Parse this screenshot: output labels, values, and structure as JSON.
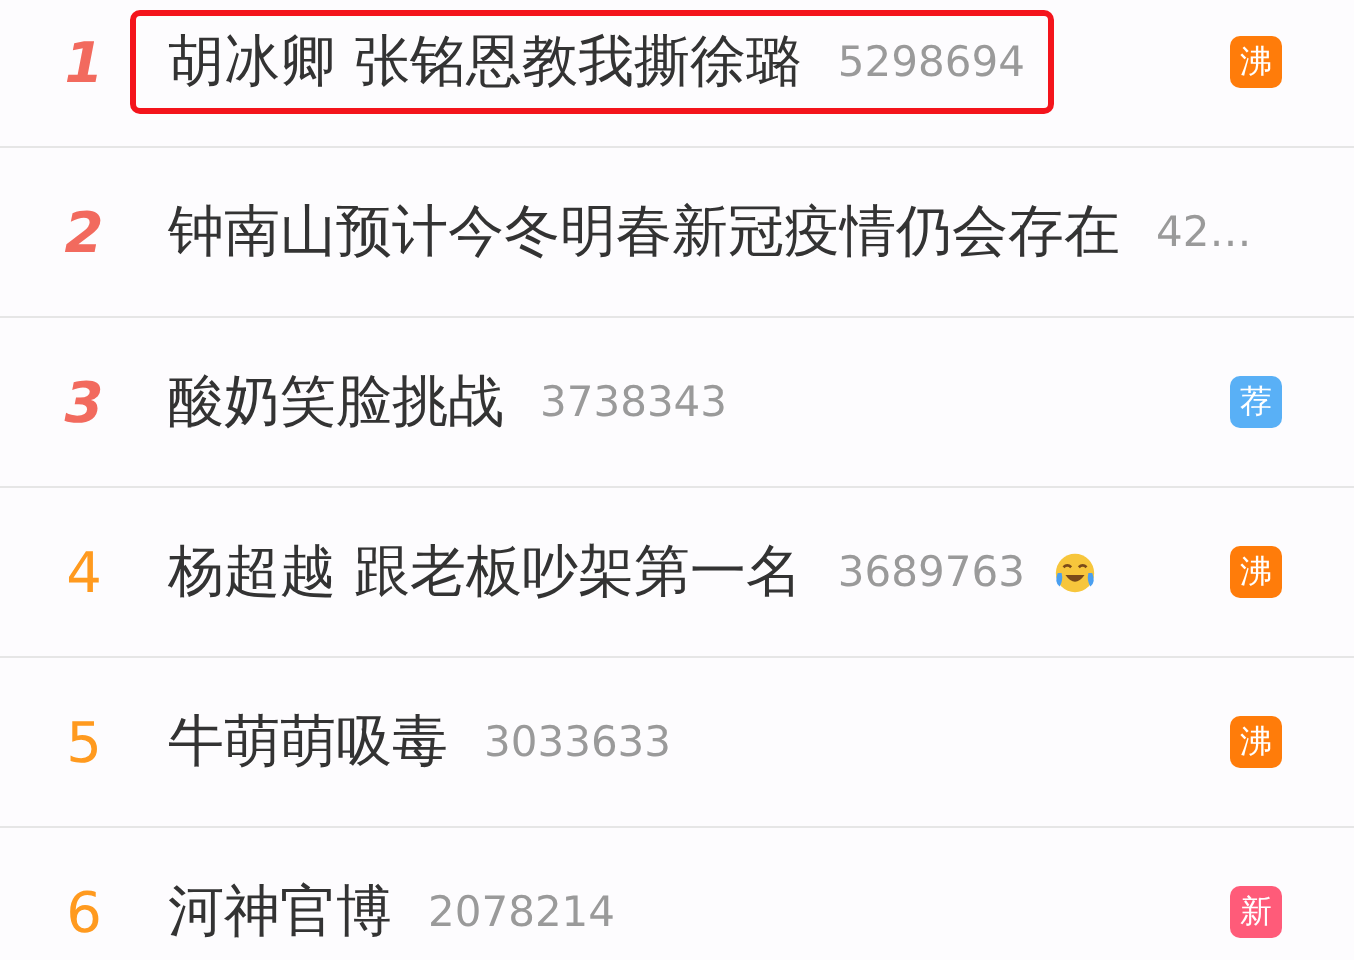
{
  "hot_list": [
    {
      "rank": "1",
      "top": true,
      "title": "胡冰卿 张铭恩教我撕徐璐",
      "count": "5298694",
      "highlighted": true,
      "emoji": false,
      "badge": {
        "label": "沸",
        "color": "#ff7c0a"
      }
    },
    {
      "rank": "2",
      "top": true,
      "title": "钟南山预计今冬明春新冠疫情仍会存在",
      "count": "42…",
      "highlighted": false,
      "emoji": false
    },
    {
      "rank": "3",
      "top": true,
      "title": "酸奶笑脸挑战",
      "count": "3738343",
      "highlighted": false,
      "emoji": false,
      "badge": {
        "label": "荐",
        "color": "#59b0f6"
      }
    },
    {
      "rank": "4",
      "top": false,
      "title": "杨超越 跟老板吵架第一名",
      "count": "3689763",
      "highlighted": false,
      "emoji": true,
      "badge": {
        "label": "沸",
        "color": "#ff7c0a"
      }
    },
    {
      "rank": "5",
      "top": false,
      "title": "牛萌萌吸毒",
      "count": "3033633",
      "highlighted": false,
      "emoji": false,
      "badge": {
        "label": "沸",
        "color": "#ff7c0a"
      }
    },
    {
      "rank": "6",
      "top": false,
      "title": "河神官博",
      "count": "2078214",
      "highlighted": false,
      "emoji": false,
      "badge": {
        "label": "新",
        "color": "#ff5b79"
      }
    }
  ]
}
